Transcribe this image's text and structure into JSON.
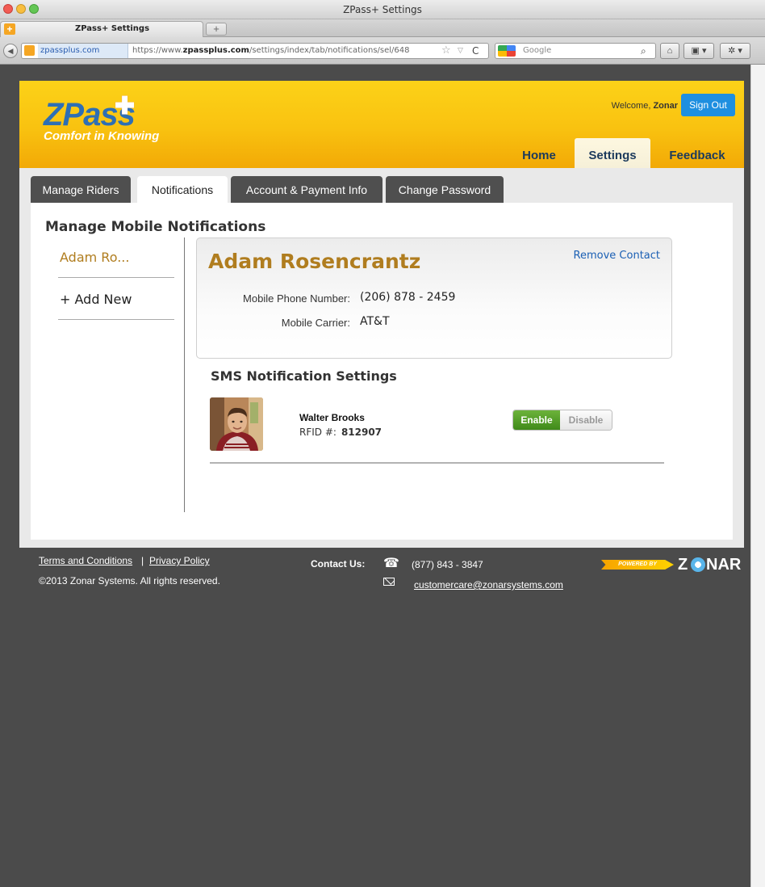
{
  "browser": {
    "window_title": "ZPass+ Settings",
    "tab_title": "ZPass+ Settings",
    "new_tab": "+",
    "url_domain": "zpassplus.com",
    "url_prefix": "https://www.",
    "url_host": "zpassplus.com",
    "url_path": "/settings/index/tab/notifications/sel/648",
    "search_placeholder": "Google"
  },
  "header": {
    "logo_text": "ZPass",
    "tagline": "Comfort in Knowing",
    "welcome_prefix": "Welcome, ",
    "welcome_user": "Zonar",
    "signout_label": "Sign Out",
    "nav": {
      "home": "Home",
      "settings": "Settings",
      "feedback": "Feedback"
    }
  },
  "tabs": {
    "riders": "Manage Riders",
    "notifications": "Notifications",
    "account": "Account & Payment Info",
    "password": "Change Password"
  },
  "notifications": {
    "title": "Manage Mobile Notifications",
    "contacts": [
      "Adam Ro..."
    ],
    "add_new": "+ Add New",
    "contact": {
      "name": "Adam Rosencrantz",
      "remove_label": "Remove Contact",
      "phone_label": "Mobile Phone Number:",
      "phone": "(206) 878 - 2459",
      "carrier_label": "Mobile Carrier:",
      "carrier": "AT&T"
    },
    "sms_title": "SMS Notification Settings",
    "rider": {
      "name": "Walter Brooks",
      "rfid_label": "RFID #:",
      "rfid": "812907",
      "enable_label": "Enable",
      "disable_label": "Disable",
      "enabled": true
    }
  },
  "footer": {
    "terms": "Terms and Conditions",
    "separator": "|",
    "privacy": "Privacy Policy",
    "copyright": "©2013 Zonar Systems. All rights reserved.",
    "contact_label": "Contact Us:",
    "phone": "(877) 843 - 3847",
    "email": "customercare@zonarsystems.com",
    "powered_by": "POWERED BY",
    "brand_z": "Z",
    "brand_rest": "NAR"
  },
  "colors": {
    "header_yellow": "#f9c210",
    "accent_blue": "#1e8fe0",
    "name_gold": "#b07d1f",
    "enable_green": "#4f9a25",
    "page_dark": "#4b4b4b"
  }
}
